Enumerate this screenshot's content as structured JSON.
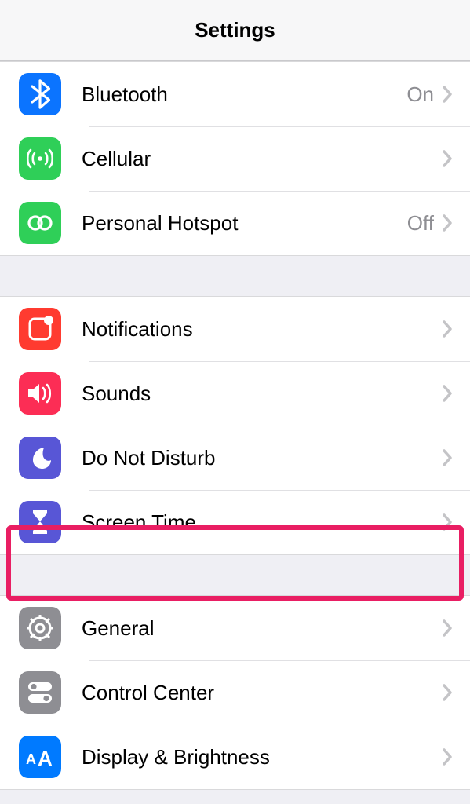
{
  "header": {
    "title": "Settings"
  },
  "group1": {
    "bluetooth": {
      "label": "Bluetooth",
      "value": "On"
    },
    "cellular": {
      "label": "Cellular",
      "value": ""
    },
    "hotspot": {
      "label": "Personal Hotspot",
      "value": "Off"
    }
  },
  "group2": {
    "notifications": {
      "label": "Notifications"
    },
    "sounds": {
      "label": "Sounds"
    },
    "dnd": {
      "label": "Do Not Disturb"
    },
    "screentime": {
      "label": "Screen Time"
    }
  },
  "group3": {
    "general": {
      "label": "General"
    },
    "controlcenter": {
      "label": "Control Center"
    },
    "display": {
      "label": "Display & Brightness"
    }
  }
}
